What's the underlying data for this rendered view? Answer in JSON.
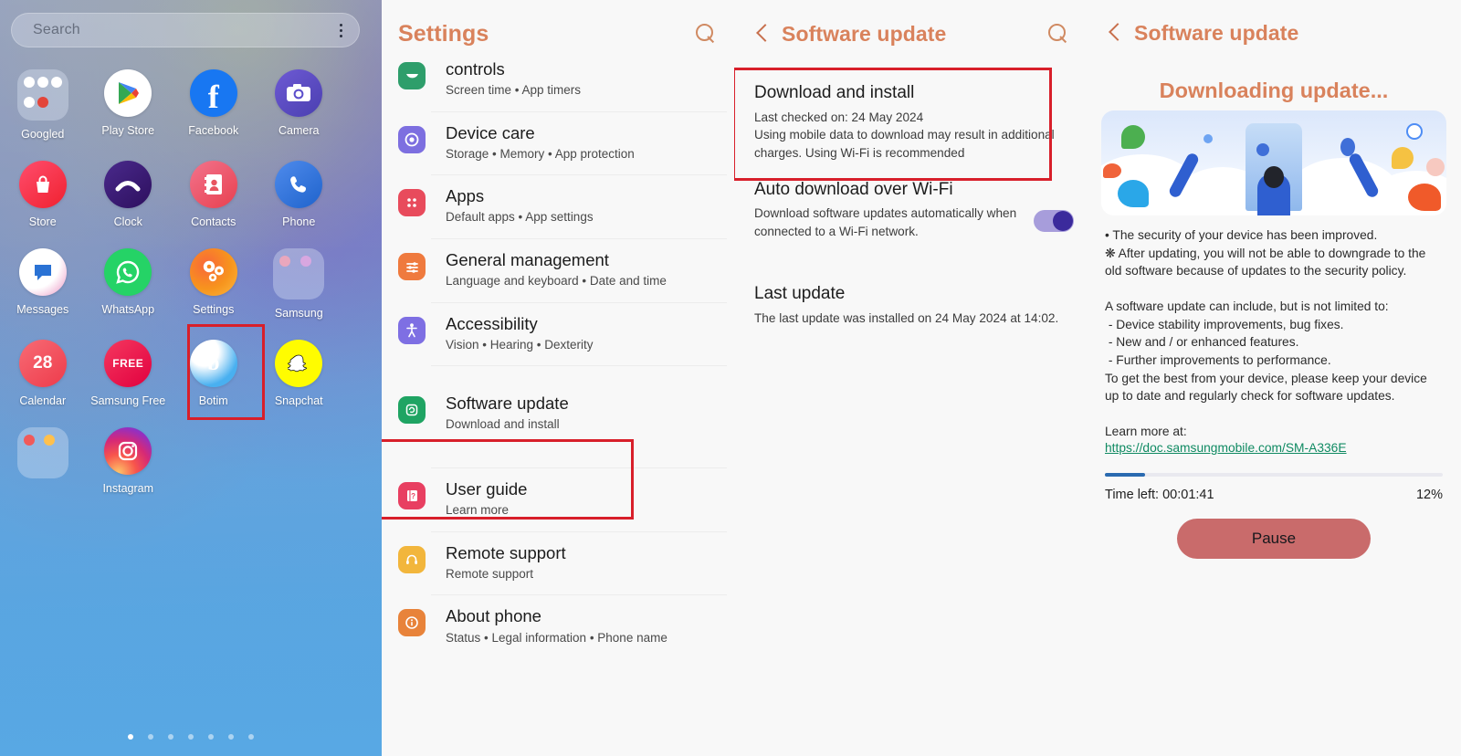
{
  "home": {
    "search_placeholder": "Search",
    "menu_icon": "kebab-menu-icon",
    "rows": [
      [
        {
          "label": "Googled",
          "icon": "google-folder-icon",
          "type": "folder",
          "colors": [
            "#ffffff",
            "#ffffff",
            "#ffffff",
            "#ffffff",
            "#e3453a"
          ]
        },
        {
          "label": "Play Store",
          "icon": "play-store-icon",
          "type": "app",
          "color": "#ffffff"
        },
        {
          "label": "Facebook",
          "icon": "facebook-icon",
          "type": "app",
          "color": "#1877f2"
        },
        {
          "label": "Camera",
          "icon": "camera-icon",
          "type": "app",
          "color": "#5b4ecb"
        }
      ],
      [
        {
          "label": "Store",
          "icon": "galaxy-store-icon",
          "type": "app",
          "color": "#f5333f"
        },
        {
          "label": "Clock",
          "icon": "clock-icon",
          "type": "app",
          "color": "#3b2070"
        },
        {
          "label": "Contacts",
          "icon": "contacts-icon",
          "type": "app",
          "color": "#e8555f"
        },
        {
          "label": "Phone",
          "icon": "phone-icon",
          "type": "app",
          "color": "#2a72d4"
        }
      ],
      [
        {
          "label": "Messages",
          "icon": "messages-icon",
          "type": "app",
          "color": "#ffffff"
        },
        {
          "label": "WhatsApp",
          "icon": "whatsapp-icon",
          "type": "app",
          "color": "#25d366"
        },
        {
          "label": "Settings",
          "icon": "settings-gear-icon",
          "type": "app",
          "color": "#f79520"
        },
        {
          "label": "Samsung",
          "icon": "samsung-folder-icon",
          "type": "folder",
          "colors": [
            "#e9b7c8",
            "#d8a7e0"
          ]
        }
      ],
      [
        {
          "label": "Calendar",
          "icon": "calendar-icon",
          "type": "app",
          "color": "#f0505c",
          "badge": "28"
        },
        {
          "label": "Samsung Free",
          "icon": "samsung-free-icon",
          "type": "app",
          "color": "#ef2b55",
          "badge": "FREE"
        },
        {
          "label": "Botim",
          "icon": "botim-icon",
          "type": "app",
          "color": "#39a7ee"
        },
        {
          "label": "Snapchat",
          "icon": "snapchat-icon",
          "type": "app",
          "color": "#fffc00"
        }
      ],
      [
        {
          "label": "",
          "icon": "media-folder-icon",
          "type": "folder",
          "colors": [
            "#f05a5a",
            "#ffc04d"
          ]
        },
        {
          "label": "Instagram",
          "icon": "instagram-icon",
          "type": "app",
          "color": "#d62976"
        }
      ]
    ],
    "page_dots": {
      "count": 7,
      "active_index": 0
    }
  },
  "settings_panel": {
    "title": "Settings",
    "search_icon": "search-icon",
    "items": [
      {
        "name": "controls",
        "sub": "Screen time  •  App timers",
        "icon": "digital-wellbeing-icon",
        "color": "#2e9e6b"
      },
      {
        "name": "Device care",
        "sub": "Storage  •  Memory  •  App protection",
        "icon": "device-care-icon",
        "color": "#7d6fe0"
      },
      {
        "name": "Apps",
        "sub": "Default apps  •  App settings",
        "icon": "apps-grid-icon",
        "color": "#e84b5c"
      },
      {
        "name": "General management",
        "sub": "Language and keyboard  •  Date and time",
        "icon": "sliders-icon",
        "color": "#ef7a3e"
      },
      {
        "name": "Accessibility",
        "sub": "Vision  •  Hearing  •  Dexterity",
        "icon": "accessibility-icon",
        "color": "#7e6fe3"
      },
      {
        "name": "Software update",
        "sub": "Download and install",
        "icon": "software-update-icon",
        "color": "#1fa463"
      },
      {
        "name": "User guide",
        "sub": "Learn more",
        "icon": "user-guide-icon",
        "color": "#e83f61"
      },
      {
        "name": "Remote support",
        "sub": "Remote support",
        "icon": "headset-icon",
        "color": "#f2b63c"
      },
      {
        "name": "About phone",
        "sub": "Status  •  Legal information  •  Phone name",
        "icon": "info-icon",
        "color": "#e8833a"
      }
    ],
    "highlight": "software-update-row"
  },
  "update_panel": {
    "title": "Software update",
    "back_icon": "back-chevron-icon",
    "search_icon": "search-icon",
    "download": {
      "title": "Download and install",
      "line1": "Last checked on: 24 May 2024",
      "line2": "Using mobile data to download may result in additional charges. Using Wi-Fi is recommended"
    },
    "auto_download": {
      "title": "Auto download over Wi-Fi",
      "body": "Download software updates automatically when connected to a Wi-Fi network.",
      "toggle_state": "on",
      "toggle_color": "#3b2a9c"
    },
    "last_update": {
      "title": "Last update",
      "body": "The last update was installed on 24 May 2024 at 14:02."
    },
    "highlight": "download-and-install-card"
  },
  "downloading_panel": {
    "title": "Software update",
    "back_icon": "back-chevron-icon",
    "heading": "Downloading update...",
    "illustration": "samsung-update-celebration-illustration",
    "notes": "• The security of your device has been improved.\n❋ After updating, you will not be able to downgrade to the old software because of updates to the security policy.\n\nA software update can include, but is not limited to:\n - Device stability improvements, bug fixes.\n - New and / or enhanced features.\n - Further improvements to performance.\nTo get the best from your device, please keep your device up to date and regularly check for software updates.\n\nLearn more at:",
    "learn_more_url": "https://doc.samsungmobile.com/SM-A336E",
    "progress_percent_label": "12%",
    "progress_percent_value": 12,
    "time_left": "Time left: 00:01:41",
    "pause_label": "Pause",
    "accent_color": "#d9825c",
    "progress_color": "#2a6ab0",
    "pause_button_color": "#c96b6b"
  }
}
